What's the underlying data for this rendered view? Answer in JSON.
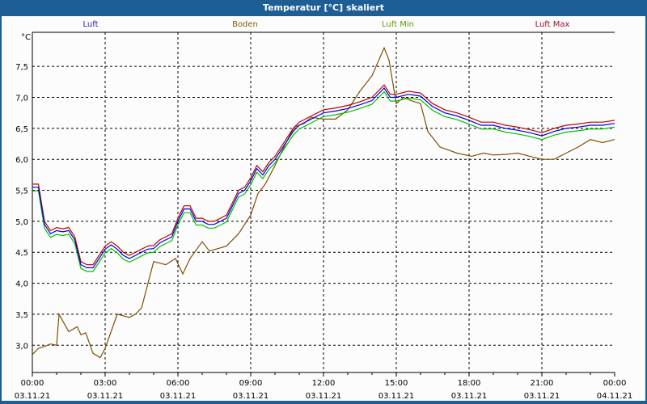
{
  "window": {
    "title": "Temperatur [°C] skaliert"
  },
  "chart_data": {
    "type": "line",
    "title": "Temperatur [°C] skaliert",
    "ylabel": "°C",
    "xlabel": "",
    "ylim": [
      2.56,
      8.05
    ],
    "xlim_hours": [
      0,
      24
    ],
    "grid": true,
    "legend_placement": "top",
    "yticks": [
      3.0,
      3.5,
      4.0,
      4.5,
      5.0,
      5.5,
      6.0,
      6.5,
      7.0,
      7.5
    ],
    "ytick_labels": [
      "3,0",
      "3,5",
      "4,0",
      "4,5",
      "5,0",
      "5,5",
      "6,0",
      "6,5",
      "7,0",
      "7,5"
    ],
    "xticks": [
      {
        "h": 0,
        "time": "00:00",
        "date": "03.11.21"
      },
      {
        "h": 3,
        "time": "03:00",
        "date": "03.11.21"
      },
      {
        "h": 6,
        "time": "06:00",
        "date": "03.11.21"
      },
      {
        "h": 9,
        "time": "09:00",
        "date": "03.11.21"
      },
      {
        "h": 12,
        "time": "12:00",
        "date": "03.11.21"
      },
      {
        "h": 15,
        "time": "15:00",
        "date": "03.11.21"
      },
      {
        "h": 18,
        "time": "18:00",
        "date": "03.11.21"
      },
      {
        "h": 21,
        "time": "21:00",
        "date": "03.11.21"
      },
      {
        "h": 24,
        "time": "00:00",
        "date": "04.11.21"
      }
    ],
    "series": [
      {
        "name": "Luft",
        "color": "#0000e0",
        "label_color": "#3a1a9a",
        "offset": 0,
        "x": [
          0,
          0.25,
          0.5,
          0.75,
          1,
          1.25,
          1.5,
          1.75,
          2,
          2.25,
          2.5,
          2.75,
          3,
          3.25,
          3.5,
          3.75,
          4,
          4.25,
          4.5,
          4.75,
          5,
          5.25,
          5.5,
          5.75,
          6,
          6.25,
          6.5,
          6.75,
          7,
          7.25,
          7.5,
          7.75,
          8,
          8.25,
          8.5,
          8.75,
          9,
          9.25,
          9.5,
          9.75,
          10,
          10.25,
          10.5,
          10.75,
          11,
          11.25,
          11.5,
          11.75,
          12,
          12.5,
          13,
          13.5,
          14,
          14.5,
          14.75,
          15,
          15.5,
          16,
          16.5,
          17,
          17.5,
          18,
          18.5,
          19,
          19.5,
          20,
          20.5,
          21,
          21.5,
          22,
          22.5,
          23,
          23.5,
          24
        ],
        "y": [
          5.55,
          5.55,
          4.95,
          4.8,
          4.85,
          4.83,
          4.85,
          4.7,
          4.3,
          4.25,
          4.25,
          4.4,
          4.55,
          4.62,
          4.55,
          4.45,
          4.4,
          4.45,
          4.5,
          4.55,
          4.56,
          4.65,
          4.7,
          4.75,
          5.0,
          5.2,
          5.2,
          5.0,
          5.0,
          4.95,
          4.95,
          5.0,
          5.05,
          5.25,
          5.45,
          5.5,
          5.65,
          5.85,
          5.75,
          5.9,
          6.0,
          6.15,
          6.3,
          6.45,
          6.55,
          6.6,
          6.65,
          6.7,
          6.75,
          6.78,
          6.82,
          6.88,
          6.95,
          7.15,
          7.0,
          7.0,
          7.05,
          7.02,
          6.85,
          6.75,
          6.7,
          6.63,
          6.55,
          6.55,
          6.5,
          6.47,
          6.43,
          6.38,
          6.45,
          6.5,
          6.52,
          6.55,
          6.55,
          6.58
        ]
      },
      {
        "name": "Boden",
        "color": "#7f5000",
        "label_color": "#8b5a00",
        "x": [
          0,
          0.25,
          0.5,
          0.75,
          1,
          1.1,
          1.5,
          1.85,
          2,
          2.2,
          2.5,
          2.8,
          3,
          3.5,
          4,
          4.25,
          4.5,
          5,
          5.5,
          5.9,
          6.2,
          6.5,
          7,
          7.3,
          8,
          8.5,
          9,
          9.3,
          9.6,
          10,
          10.5,
          10.8,
          11.2,
          11.5,
          12,
          12.5,
          13,
          13.5,
          14,
          14.5,
          14.7,
          15,
          15.3,
          15.6,
          16,
          16.3,
          16.8,
          17.5,
          18.1,
          18.6,
          19,
          19.5,
          20,
          20.5,
          21,
          21.5,
          22,
          22.5,
          23,
          23.5,
          24
        ],
        "y": [
          2.85,
          2.95,
          2.98,
          3.02,
          3.0,
          3.5,
          3.22,
          3.3,
          3.17,
          3.2,
          2.87,
          2.8,
          2.95,
          3.5,
          3.45,
          3.5,
          3.6,
          4.35,
          4.3,
          4.4,
          4.15,
          4.4,
          4.67,
          4.52,
          4.6,
          4.8,
          5.1,
          5.45,
          5.6,
          5.9,
          6.3,
          6.52,
          6.58,
          6.68,
          6.65,
          6.65,
          6.8,
          7.1,
          7.35,
          7.8,
          7.6,
          6.9,
          7.0,
          6.95,
          6.9,
          6.45,
          6.2,
          6.1,
          6.05,
          6.1,
          6.07,
          6.08,
          6.1,
          6.05,
          6.0,
          6.0,
          6.1,
          6.2,
          6.32,
          6.27,
          6.32
        ]
      },
      {
        "name": "Luft Min",
        "color": "#00c000",
        "label_color": "#5aa000",
        "offset": -0.06
      },
      {
        "name": "Luft Max",
        "color": "#c00000",
        "label_color": "#a01030",
        "offset": 0.05
      }
    ]
  }
}
